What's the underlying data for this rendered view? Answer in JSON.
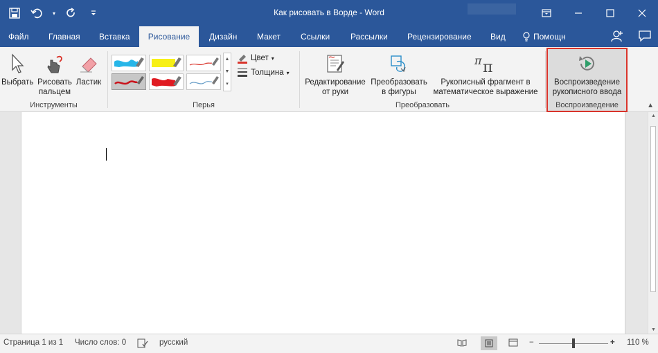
{
  "window": {
    "title": "Как рисовать в Ворде  -  Word"
  },
  "tabs": [
    "Файл",
    "Главная",
    "Вставка",
    "Рисование",
    "Дизайн",
    "Макет",
    "Ссылки",
    "Рассылки",
    "Рецензирование",
    "Вид"
  ],
  "active_tab": "Рисование",
  "help": "Помощн",
  "groups": {
    "tools": {
      "label": "Инструменты",
      "select": "Выбрать",
      "finger_line1": "Рисовать",
      "finger_line2": "пальцем",
      "eraser": "Ластик"
    },
    "pens": {
      "label": "Перья",
      "color": "Цвет",
      "thickness": "Толщина"
    },
    "convert": {
      "label": "Преобразовать",
      "edit_line1": "Редактирование",
      "edit_line2": "от руки",
      "shapes_line1": "Преобразовать",
      "shapes_line2": "в фигуры",
      "math_line1": "Рукописный фрагмент в",
      "math_line2": "математическое выражение"
    },
    "replay": {
      "label": "Воспроизведение",
      "btn_line1": "Воспроизведение",
      "btn_line2": "рукописного ввода"
    }
  },
  "status": {
    "page": "Страница 1 из 1",
    "words": "Число слов: 0",
    "language": "русский",
    "zoom": "110 %",
    "zoom_minus": "−",
    "zoom_plus": "+"
  },
  "colors": {
    "brand": "#2b579a",
    "highlight": "#d9342b"
  }
}
